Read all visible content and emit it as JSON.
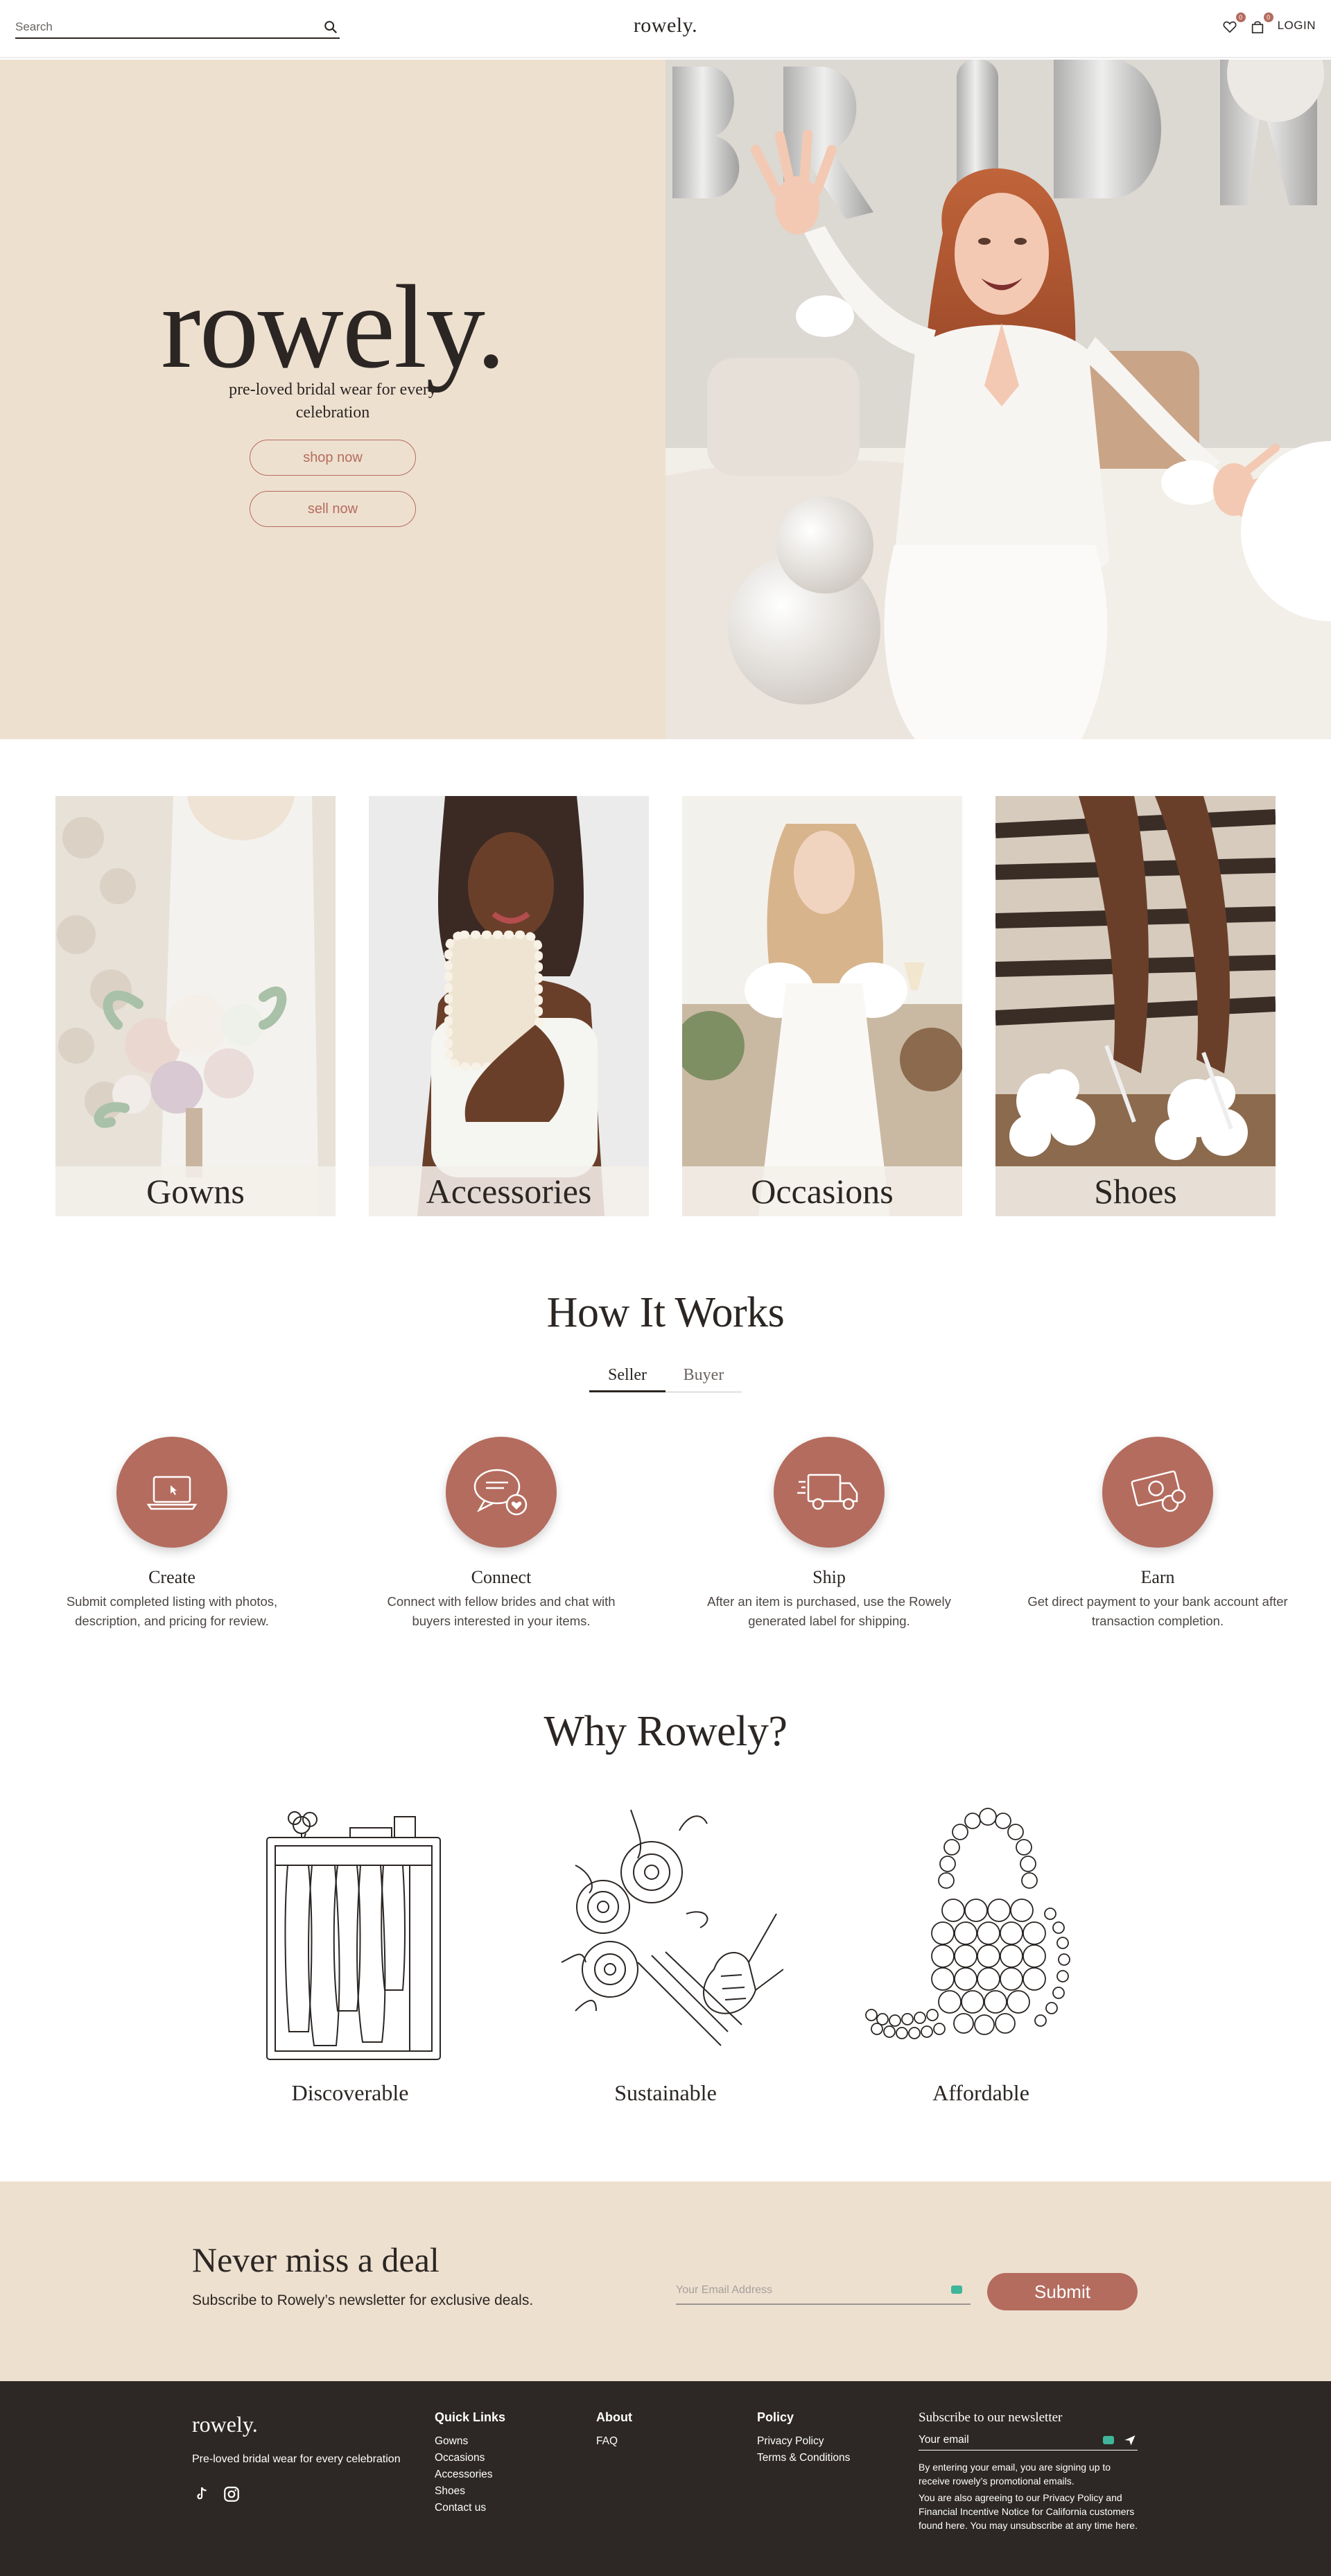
{
  "header": {
    "search_placeholder": "Search",
    "logo": "rowely.",
    "wishlist_count": "0",
    "cart_count": "0",
    "login": "LOGIN"
  },
  "hero": {
    "logo": "rowely.",
    "tagline": "pre-loved bridal wear for every celebration",
    "shop_now": "shop now",
    "sell_now": "sell now",
    "balloon_letters": [
      "B",
      "R",
      "I",
      "D"
    ]
  },
  "categories": [
    {
      "label": "Gowns"
    },
    {
      "label": "Accessories"
    },
    {
      "label": "Occasions"
    },
    {
      "label": "Shoes"
    }
  ],
  "how_it_works": {
    "title": "How It Works",
    "tabs": [
      {
        "label": "Seller",
        "active": true
      },
      {
        "label": "Buyer",
        "active": false
      }
    ],
    "steps": [
      {
        "title": "Create",
        "icon": "laptop-icon",
        "desc": "Submit completed listing with photos, description, and pricing for review."
      },
      {
        "title": "Connect",
        "icon": "chat-icon",
        "desc": "Connect with fellow brides and chat with buyers interested in your items."
      },
      {
        "title": "Ship",
        "icon": "truck-icon",
        "desc": "After an item is purchased, use the Rowely generated label for shipping."
      },
      {
        "title": "Earn",
        "icon": "money-icon",
        "desc": "Get direct payment to your bank account after transaction completion."
      }
    ]
  },
  "why": {
    "title": "Why Rowely?",
    "items": [
      {
        "label": "Discoverable",
        "icon": "wardrobe-illustration"
      },
      {
        "label": "Sustainable",
        "icon": "bouquet-illustration"
      },
      {
        "label": "Affordable",
        "icon": "pearl-bag-illustration"
      }
    ]
  },
  "newsletter": {
    "title": "Never miss a deal",
    "subtitle": "Subscribe to Rowely’s newsletter for exclusive deals.",
    "placeholder": "Your Email Address",
    "submit": "Submit"
  },
  "footer": {
    "logo": "rowely.",
    "tagline": "Pre-loved bridal wear for every celebration",
    "quick_links": {
      "title": "Quick Links",
      "links": [
        "Gowns",
        "Occasions",
        "Accessories",
        "Shoes",
        "Contact us"
      ]
    },
    "about": {
      "title": "About",
      "links": [
        "FAQ"
      ]
    },
    "policy": {
      "title": "Policy",
      "links": [
        "Privacy Policy",
        "Terms & Conditions"
      ]
    },
    "newsletter": {
      "title": "Subscribe to our newsletter",
      "placeholder": "Your email",
      "disclaimer_1": "By entering your email, you are signing up to receive rowely’s promotional emails.",
      "disclaimer_2": "You are also agreeing to our Privacy Policy and Financial Incentive Notice for California customers found here. You may unsubscribe at any time here."
    }
  },
  "colors": {
    "accent": "#b46c5e",
    "cream": "#eee0cf",
    "footer": "#2d2825",
    "text": "#2b2623"
  }
}
